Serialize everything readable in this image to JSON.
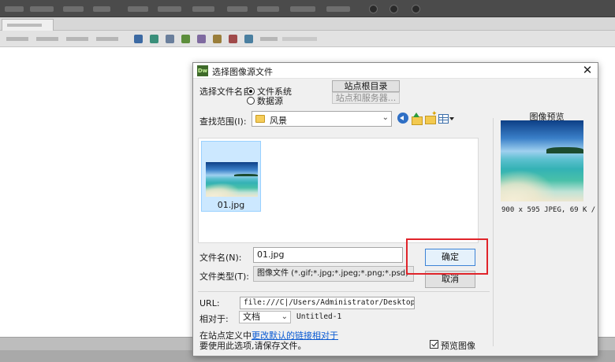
{
  "dialog": {
    "title": "选择图像源文件",
    "logo_text": "Dw",
    "select_filename_label": "选择文件名自:",
    "radio_filesystem": "文件系统",
    "radio_datasource": "数据源",
    "site_root_button": "站点根目录",
    "site_server_button": "站点和服务器...",
    "lookin_label": "查找范围(I):",
    "lookin_value": "风景",
    "file_item_name": "01.jpg",
    "filename_label": "文件名(N):",
    "filename_value": "01.jpg",
    "filetype_label": "文件类型(T):",
    "filetype_value": "图像文件 (*.gif;*.jpg;*.jpeg;*.png;*.psd)",
    "ok_button": "确定",
    "cancel_button": "取消",
    "url_label": "URL:",
    "url_value": "file:///C|/Users/Administrator/Desktop/新建文件夹",
    "relative_label": "相对于:",
    "relative_value": "文档",
    "relative_doc": "Untitled-1",
    "note_prefix": "在站点定义中",
    "note_link": "更改默认的链接相对于",
    "note_line2": "要使用此选项,请保存文件。",
    "preview_title": "图像预览",
    "preview_info": "900 x 595 JPEG, 69 K /",
    "preview_checkbox": "预览图像"
  },
  "colors": {
    "highlight_box": "#e0242a",
    "selection_bg": "#cce8ff",
    "link": "#0b5bd3"
  }
}
